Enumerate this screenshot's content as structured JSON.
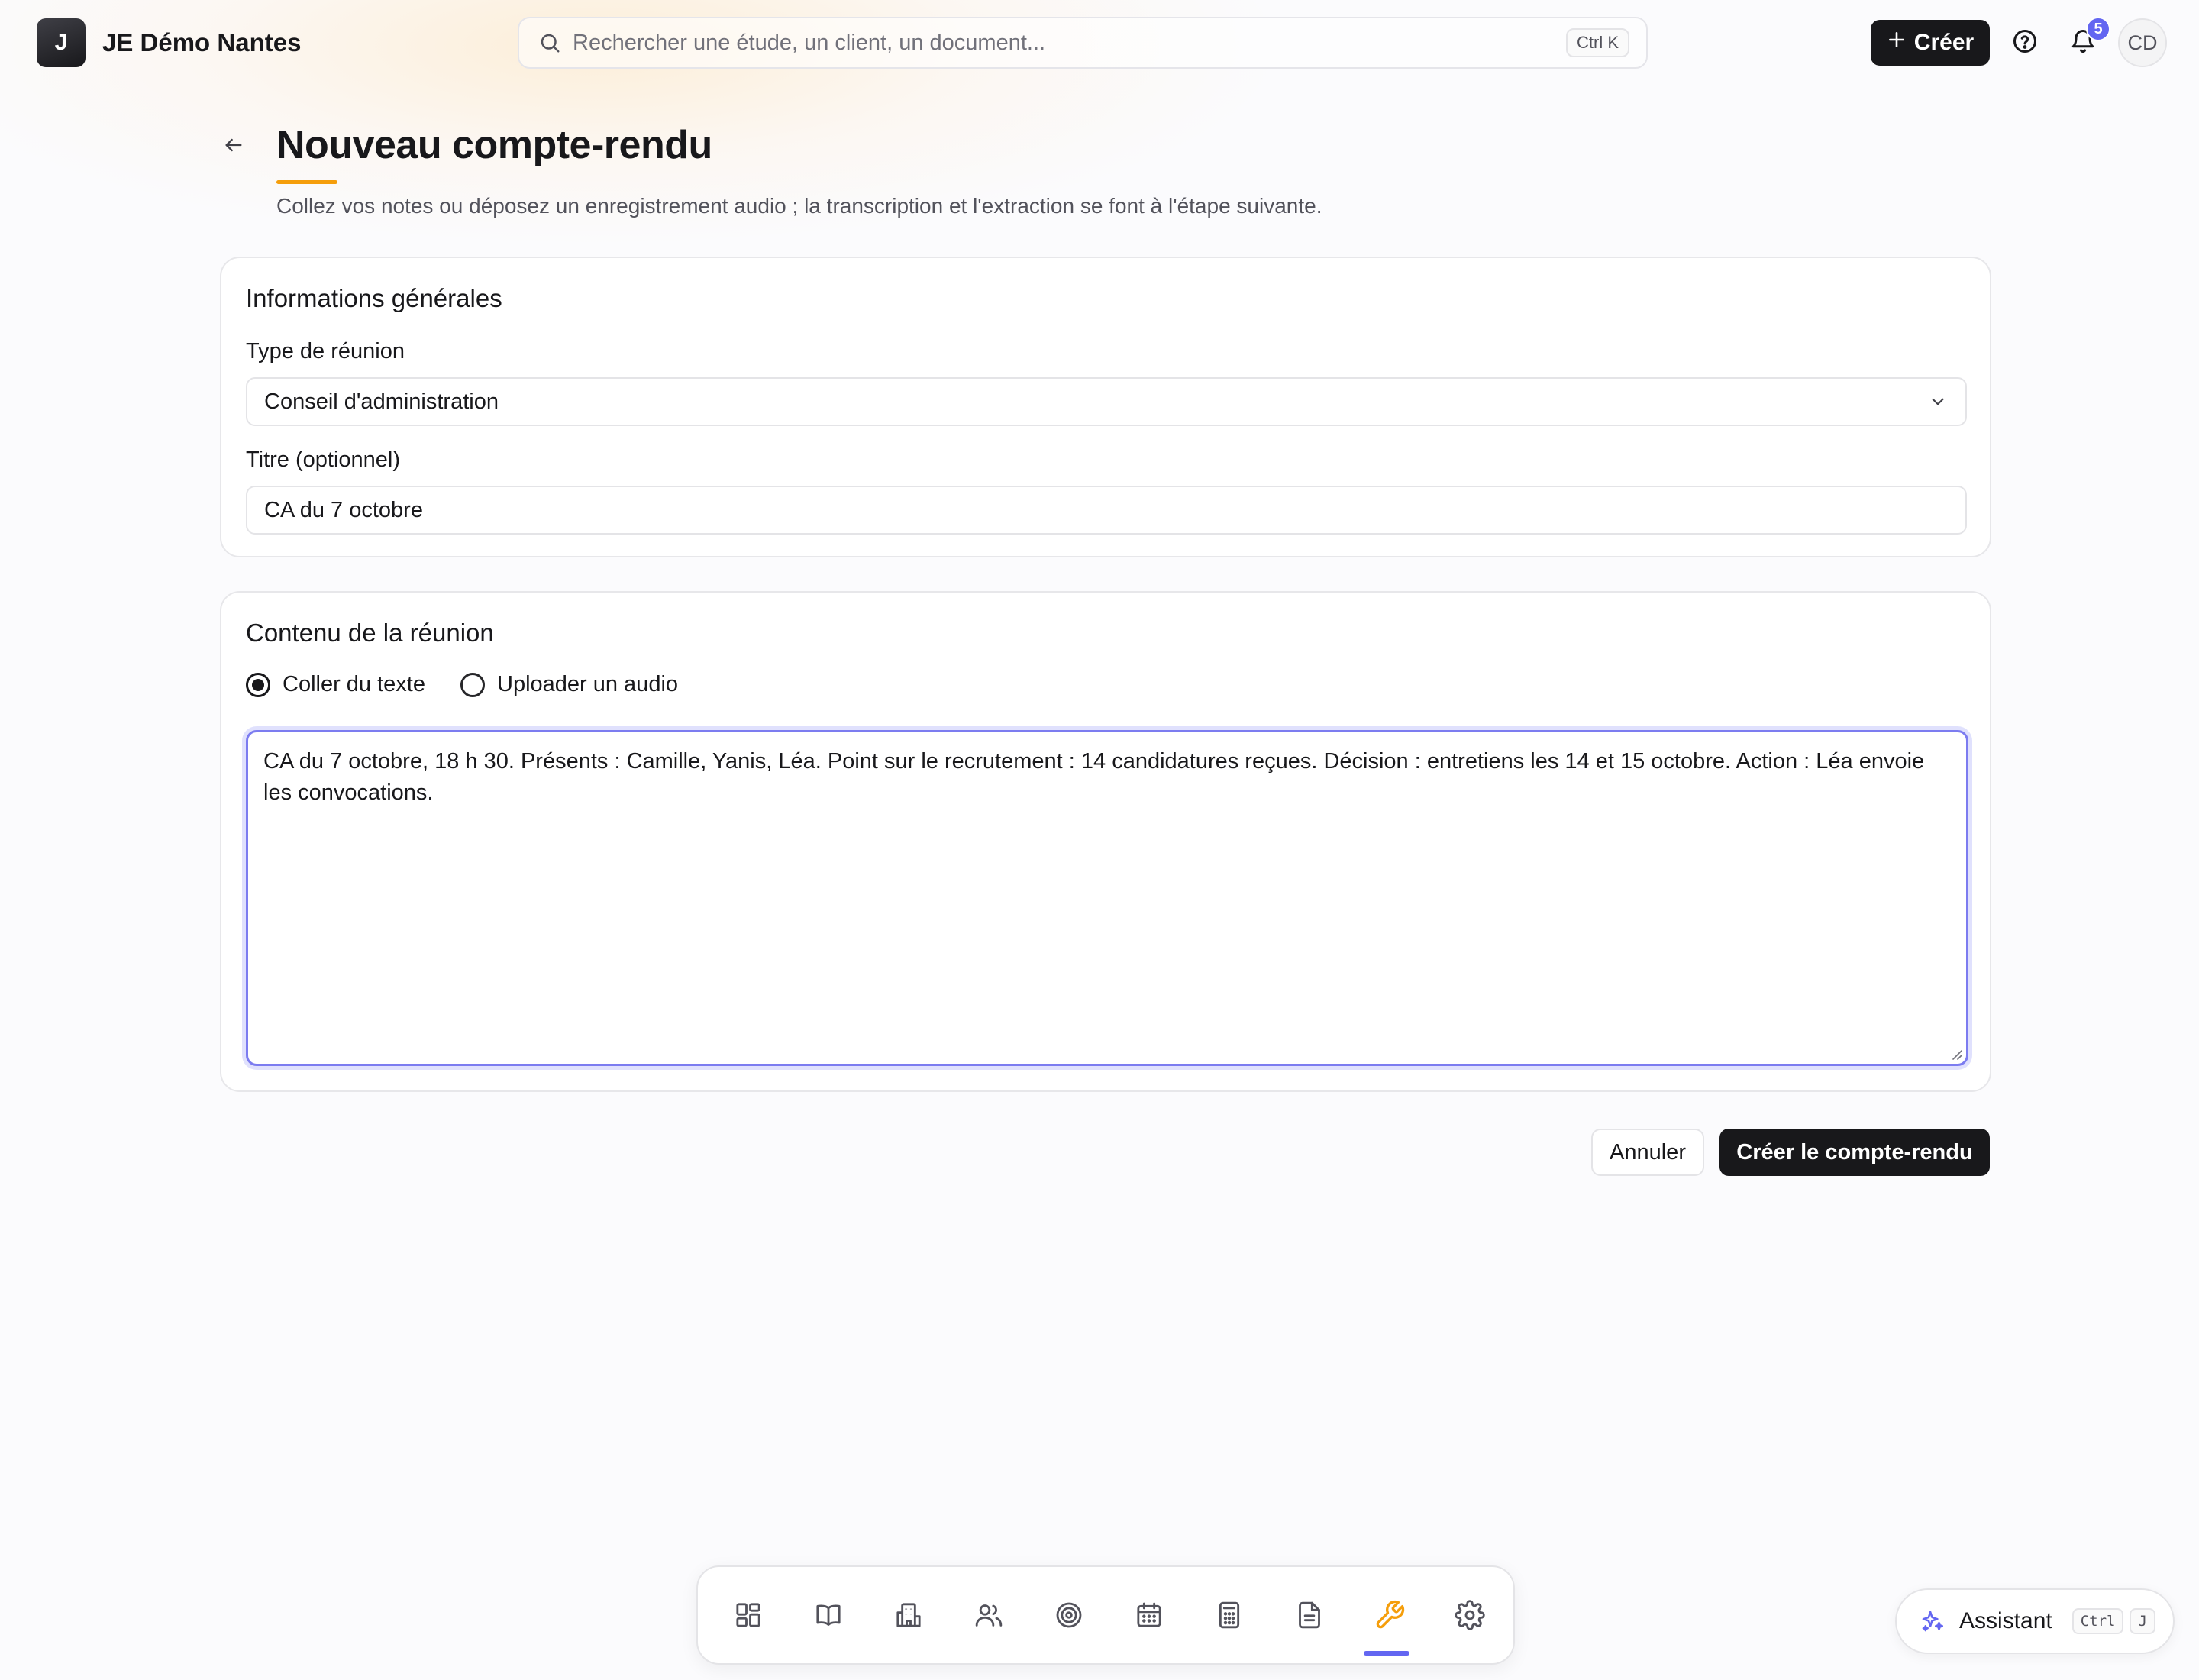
{
  "app": {
    "brand_initial": "J",
    "brand_name": "JE Démo Nantes"
  },
  "topbar": {
    "search_placeholder": "Rechercher une étude, un client, un document...",
    "search_shortcut": "Ctrl K",
    "create_label": "Créer",
    "notification_count": "5",
    "avatar_initials": "CD"
  },
  "page": {
    "title": "Nouveau compte-rendu",
    "subtitle": "Collez vos notes ou déposez un enregistrement audio ; la transcription et l'extraction se font à l'étape suivante."
  },
  "general_info": {
    "heading": "Informations générales",
    "meeting_type_label": "Type de réunion",
    "meeting_type_value": "Conseil d'administration",
    "title_label": "Titre (optionnel)",
    "title_value": "CA du 7 octobre"
  },
  "meeting_content": {
    "heading": "Contenu de la réunion",
    "option_text": "Coller du texte",
    "option_audio": "Uploader un audio",
    "selected_option": "text",
    "text_value": "CA du 7 octobre, 18 h 30. Présents : Camille, Yanis, Léa. Point sur le recrutement : 14 candidatures reçues. Décision : entretiens les 14 et 15 octobre. Action : Léa envoie les convocations."
  },
  "actions": {
    "cancel_label": "Annuler",
    "submit_label": "Créer le compte-rendu"
  },
  "dock": {
    "items": [
      {
        "icon": "dashboard-icon"
      },
      {
        "icon": "book-icon"
      },
      {
        "icon": "building-icon"
      },
      {
        "icon": "users-icon"
      },
      {
        "icon": "target-icon"
      },
      {
        "icon": "calendar-icon"
      },
      {
        "icon": "calculator-icon"
      },
      {
        "icon": "document-icon"
      },
      {
        "icon": "wrench-icon",
        "active": true
      },
      {
        "icon": "settings-icon"
      }
    ]
  },
  "assistant": {
    "label": "Assistant",
    "shortcut_modifier": "Ctrl",
    "shortcut_key": "J"
  },
  "colors": {
    "accent": "#6366f1",
    "highlight": "#f59e0b",
    "primary_button": "#18181b",
    "focus_ring": "#7c7cf0"
  }
}
